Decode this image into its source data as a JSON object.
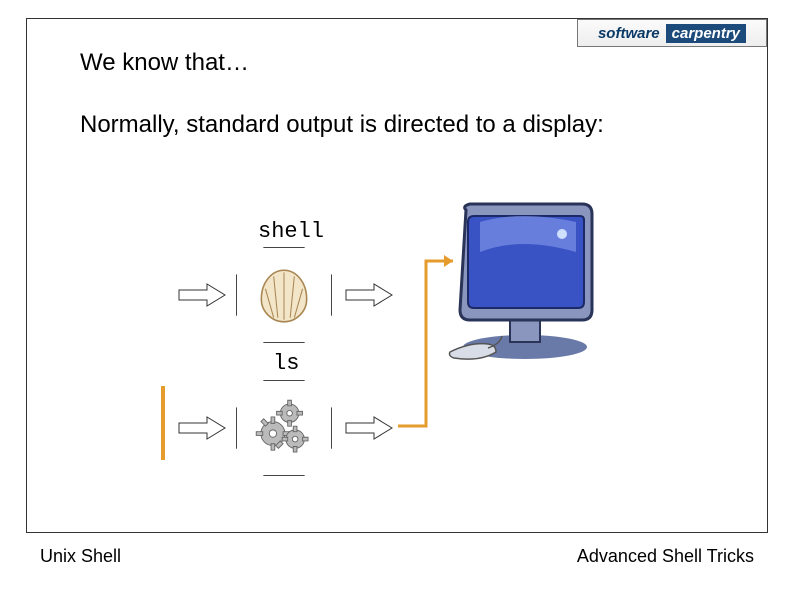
{
  "logo": {
    "word1": "software",
    "word2": "carpentry"
  },
  "heading1": "We know that…",
  "heading2": "Normally, standard output is directed to a display:",
  "labels": {
    "shell": "shell",
    "ls": "ls"
  },
  "footer": {
    "left": "Unix Shell",
    "right": "Advanced Shell Tricks"
  },
  "colors": {
    "orange": "#e69b2d",
    "navy": "#1c4a7a"
  }
}
